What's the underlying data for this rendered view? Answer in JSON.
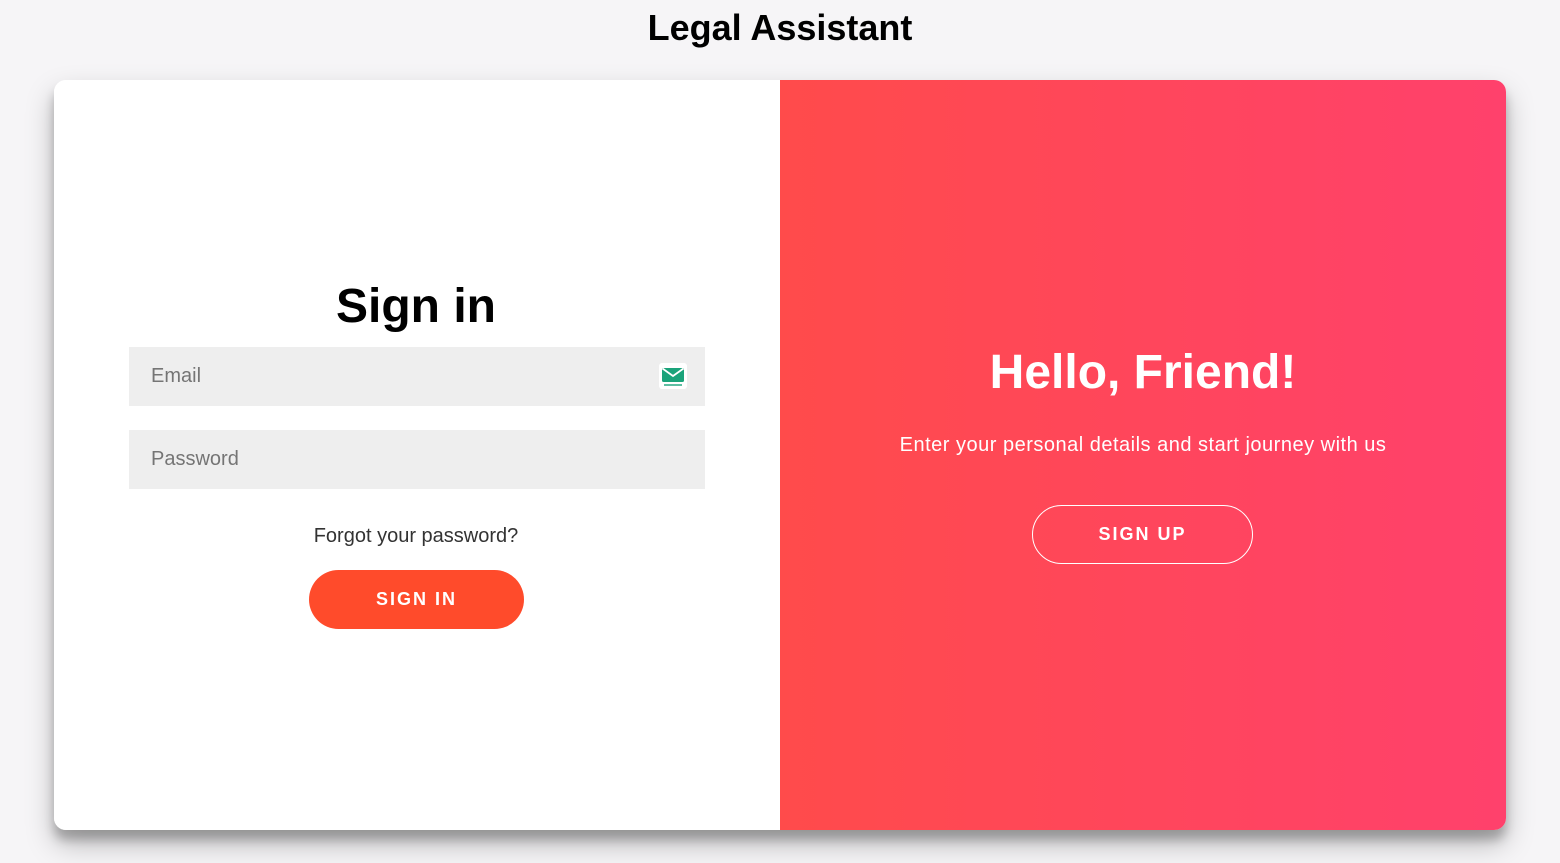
{
  "app": {
    "title": "Legal Assistant"
  },
  "signin": {
    "heading": "Sign in",
    "email_placeholder": "Email",
    "password_placeholder": "Password",
    "forgot_label": "Forgot your password?",
    "submit_label": "SIGN IN",
    "email_field_icon": "tempmail-icon"
  },
  "overlay": {
    "heading": "Hello, Friend!",
    "text": "Enter your personal details and start journey with us",
    "signup_label": "SIGN UP"
  },
  "colors": {
    "page_background": "#f6f5f7",
    "primary_button": "#ff4b2b",
    "gradient_start": "#ff4b4b",
    "gradient_end": "#ff416c",
    "input_background": "#eeeeee",
    "tempmail_icon": "#1aa37a"
  }
}
